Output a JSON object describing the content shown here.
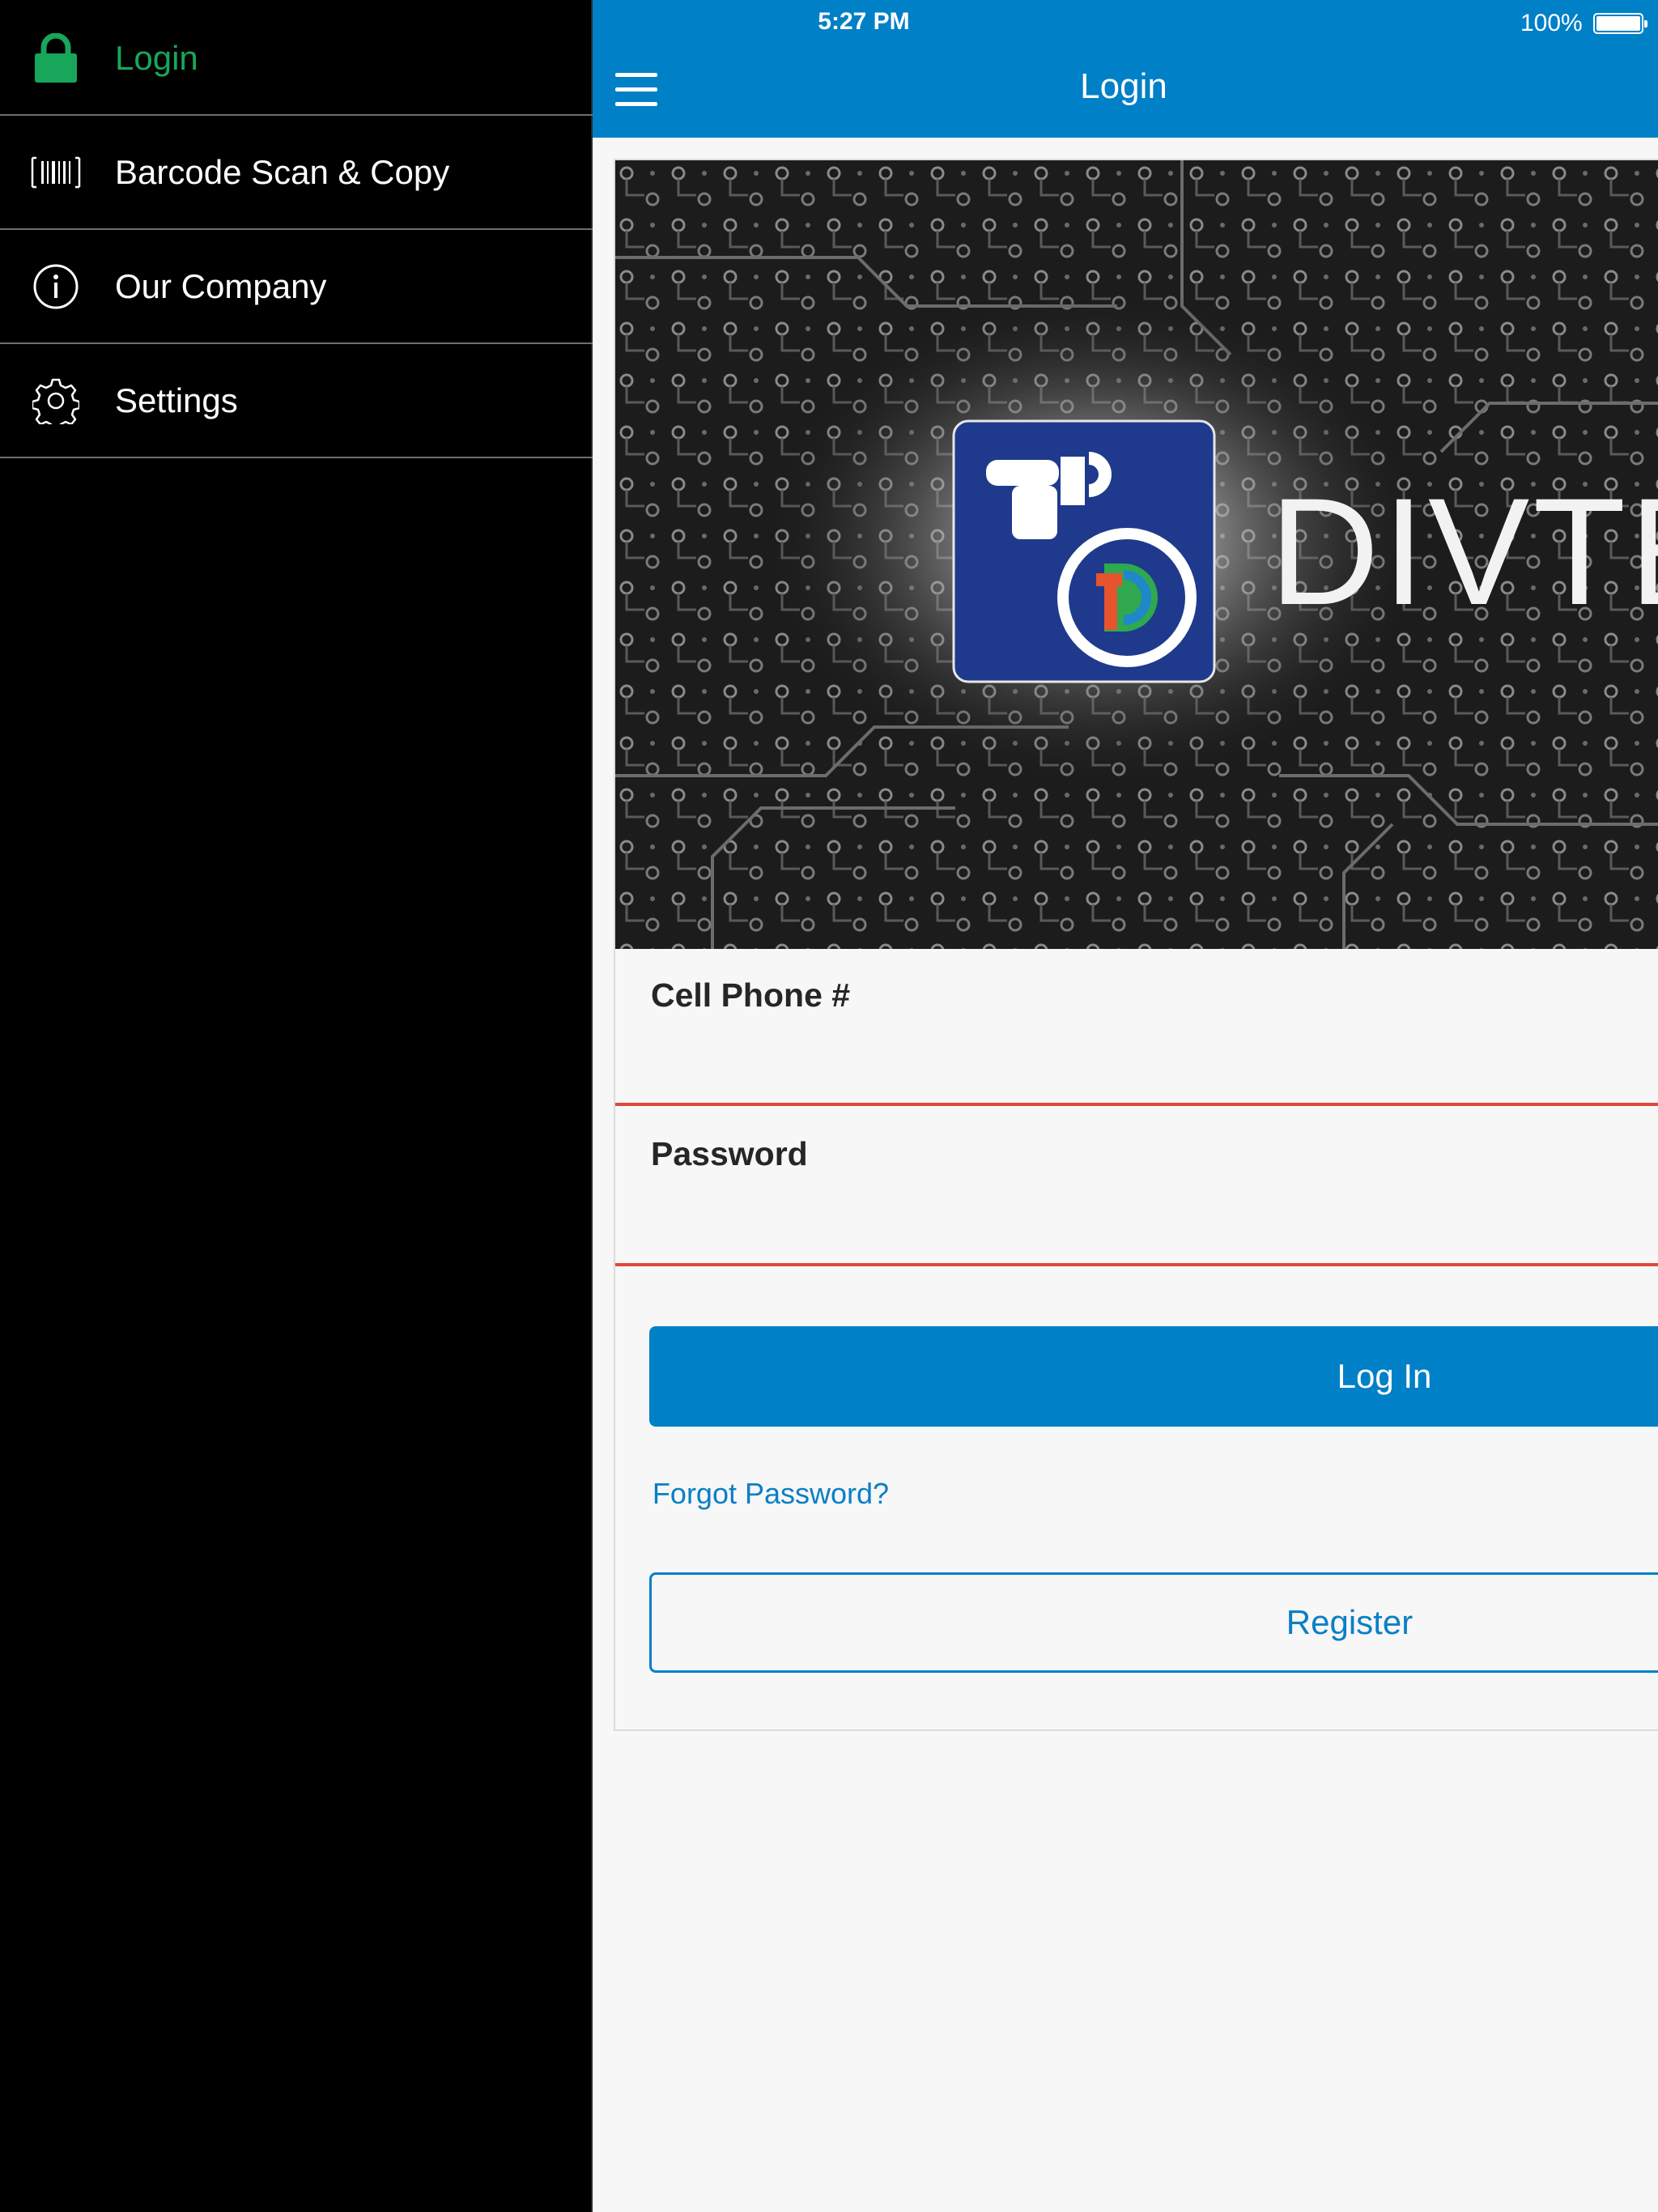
{
  "status_bar": {
    "time": "5:27 PM",
    "battery": "100%"
  },
  "sidebar": {
    "items": [
      {
        "label": "Login",
        "icon": "lock-icon",
        "active": true
      },
      {
        "label": "Barcode Scan & Copy",
        "icon": "barcode-icon",
        "active": false
      },
      {
        "label": "Our Company",
        "icon": "info-icon",
        "active": false
      },
      {
        "label": "Settings",
        "icon": "gear-icon",
        "active": false
      }
    ]
  },
  "header": {
    "title": "Login",
    "menu_icon": "hamburger-icon"
  },
  "banner": {
    "brand_text": "DIVTE"
  },
  "form": {
    "phone_label": "Cell Phone #",
    "phone_value": "",
    "password_label": "Password",
    "password_value": "",
    "login_button": "Log In",
    "forgot_link": "Forgot Password?",
    "register_button": "Register"
  },
  "colors": {
    "accent": "#0080c6",
    "active_menu": "#18a65a",
    "sidebar_bg": "#000000",
    "input_underline": "#e0483c"
  }
}
